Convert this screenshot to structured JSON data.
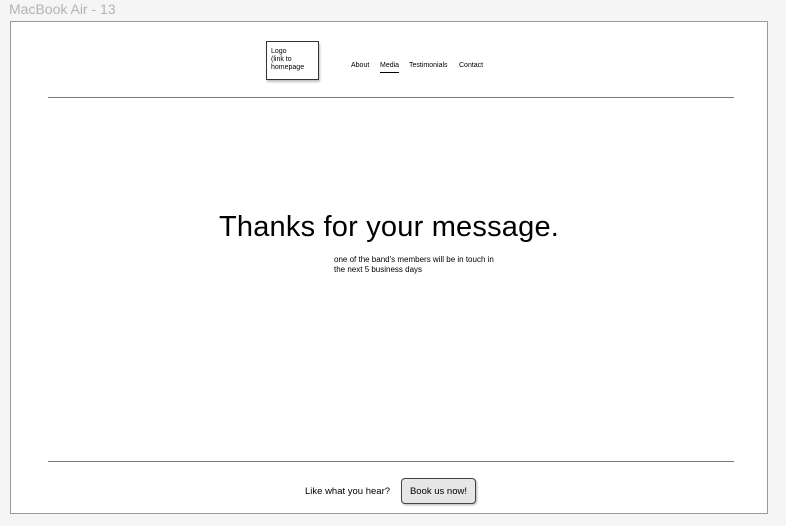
{
  "frame": {
    "title": "MacBook Air - 13"
  },
  "header": {
    "logo_text": "Logo\n(link to\nhomepage",
    "nav": [
      {
        "label": "About",
        "active": false
      },
      {
        "label": "Media",
        "active": true
      },
      {
        "label": "Testimonials",
        "active": false
      },
      {
        "label": "Contact",
        "active": false
      }
    ]
  },
  "main": {
    "headline": "Thanks for your message.",
    "subtext": "one of the band's members will be in touch in the next 5 business days"
  },
  "footer": {
    "cta_text": "Like what you hear?",
    "cta_button": "Book us now!"
  },
  "colors": {
    "canvas": "#f5f5f5",
    "frame_title": "#b3b3b3",
    "button_bg": "#e6e6e6",
    "rule": "#777777"
  }
}
